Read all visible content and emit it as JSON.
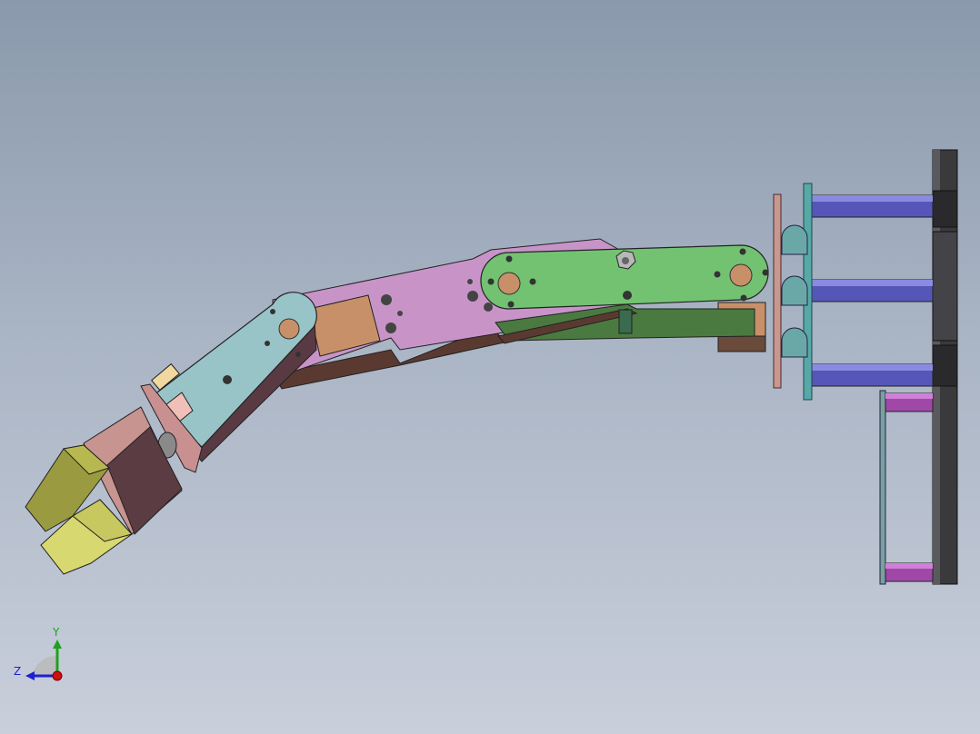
{
  "viewport": {
    "background_top": "#8a99ac",
    "background_bottom": "#c9cfdb"
  },
  "model": {
    "part_colors": {
      "gripper_finger": "#c8c860",
      "gripper_body": "#5a3c42",
      "gripper_cap": "#c89490",
      "wrist_bracket": "#98c4c8",
      "forearm": "#c898c8",
      "upper_arm": "#70c070",
      "servo": "#c89060",
      "base_plate": "#303030",
      "standoff": "#5050b0",
      "lower_standoff": "#a048a8"
    }
  },
  "triad": {
    "y_label": "Y",
    "z_label": "Z",
    "y_color": "#1fa01f",
    "z_color": "#2020d0",
    "x_color": "#d01010"
  }
}
